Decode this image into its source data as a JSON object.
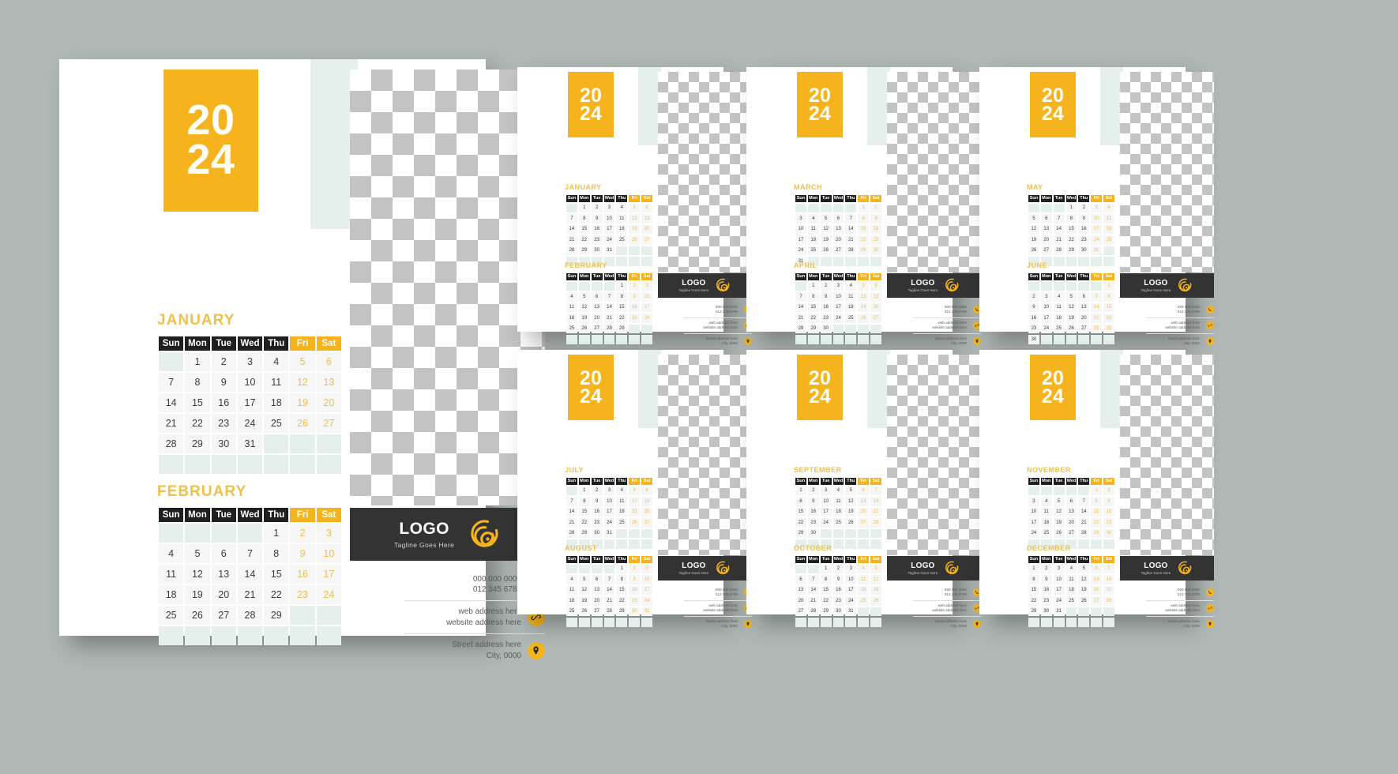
{
  "background_color": "#b0b8b5",
  "accent_color": "#f5b31d",
  "month_label_color": "#efc04a",
  "header_bg_color": "#1f1f1f",
  "logo_bar_color": "#333333",
  "empty_cell_color": "#e5efec",
  "year": "2024",
  "year_top": "20",
  "year_bottom": "24",
  "weekday_headers": [
    "Sun",
    "Mon",
    "Tue",
    "Wed",
    "Thu",
    "Fri",
    "Sat"
  ],
  "weekend_indices": [
    5,
    6
  ],
  "logo": {
    "name": "LOGO",
    "tagline": "Tagline Goes Here",
    "icon": "swirl-logo-icon"
  },
  "contact": {
    "phone": {
      "icon": "phone-icon",
      "line1": "000 000 0000",
      "line2": "012 345 6789"
    },
    "web": {
      "icon": "link-icon",
      "line1": "web address here",
      "line2": "website address here"
    },
    "address": {
      "icon": "location-pin-icon",
      "line1": "Street address here",
      "line2": "City, 0000"
    }
  },
  "months": [
    {
      "name": "JANUARY",
      "lead": 1,
      "days": 31
    },
    {
      "name": "FEBRUARY",
      "lead": 4,
      "days": 29
    },
    {
      "name": "MARCH",
      "lead": 5,
      "days": 31
    },
    {
      "name": "APRIL",
      "lead": 1,
      "days": 30
    },
    {
      "name": "MAY",
      "lead": 3,
      "days": 31
    },
    {
      "name": "JUNE",
      "lead": 6,
      "days": 30
    },
    {
      "name": "JULY",
      "lead": 1,
      "days": 31
    },
    {
      "name": "AUGUST",
      "lead": 4,
      "days": 31
    },
    {
      "name": "SEPTEMBER",
      "lead": 0,
      "days": 30
    },
    {
      "name": "OCTOBER",
      "lead": 2,
      "days": 31
    },
    {
      "name": "NOVEMBER",
      "lead": 5,
      "days": 30
    },
    {
      "name": "DECEMBER",
      "lead": 0,
      "days": 31
    }
  ],
  "pages": [
    {
      "id": "page-large",
      "months": [
        "JANUARY",
        "FEBRUARY"
      ],
      "size": "large"
    },
    {
      "id": "page-jan-feb",
      "months": [
        "JANUARY",
        "FEBRUARY"
      ],
      "size": "small"
    },
    {
      "id": "page-mar-apr",
      "months": [
        "MARCH",
        "APRIL"
      ],
      "size": "small"
    },
    {
      "id": "page-may-jun",
      "months": [
        "MAY",
        "JUNE"
      ],
      "size": "small"
    },
    {
      "id": "page-jul-aug",
      "months": [
        "JULY",
        "AUGUST"
      ],
      "size": "small"
    },
    {
      "id": "page-sep-oct",
      "months": [
        "SEPTEMBER",
        "OCTOBER"
      ],
      "size": "small"
    },
    {
      "id": "page-nov-dec",
      "months": [
        "NOVEMBER",
        "DECEMBER"
      ],
      "size": "small"
    }
  ]
}
